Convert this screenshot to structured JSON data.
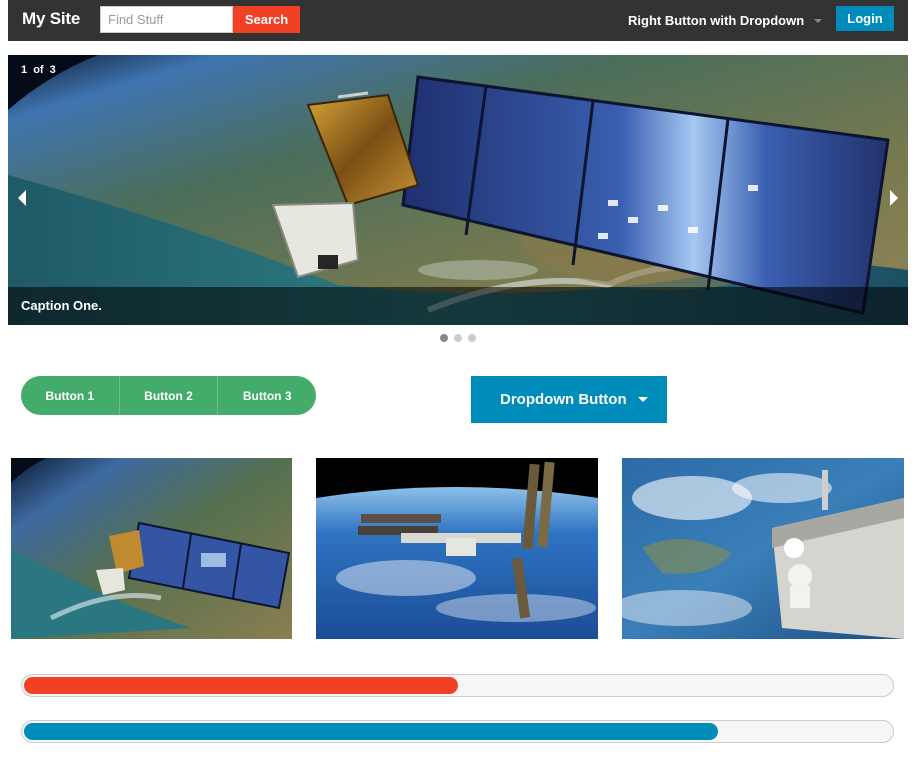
{
  "topbar": {
    "site_name": "My Site",
    "search": {
      "placeholder": "Find Stuff",
      "value": ""
    },
    "search_button": "Search",
    "right_dropdown": "Right Button with Dropdown",
    "login_button": "Login"
  },
  "carousel": {
    "counter": {
      "current": "1",
      "of": "of",
      "total": "3"
    },
    "caption": "Caption One.",
    "active_slide": 1,
    "slide_count": 3,
    "prev_icon": "chevron-left-icon",
    "next_icon": "chevron-right-icon"
  },
  "button_group": [
    "Button 1",
    "Button 2",
    "Button 3"
  ],
  "dropdown_button": "Dropdown Button",
  "thumbnails": [
    "satellite-over-earth",
    "space-station-over-earth",
    "astronaut-spacewalk"
  ],
  "progress": [
    {
      "percent": 50,
      "color": "#f04124"
    },
    {
      "percent": 80,
      "color": "#008cba"
    }
  ],
  "colors": {
    "topbar": "#333333",
    "alert": "#f04124",
    "primary": "#008cba",
    "success": "#43ac6a"
  }
}
